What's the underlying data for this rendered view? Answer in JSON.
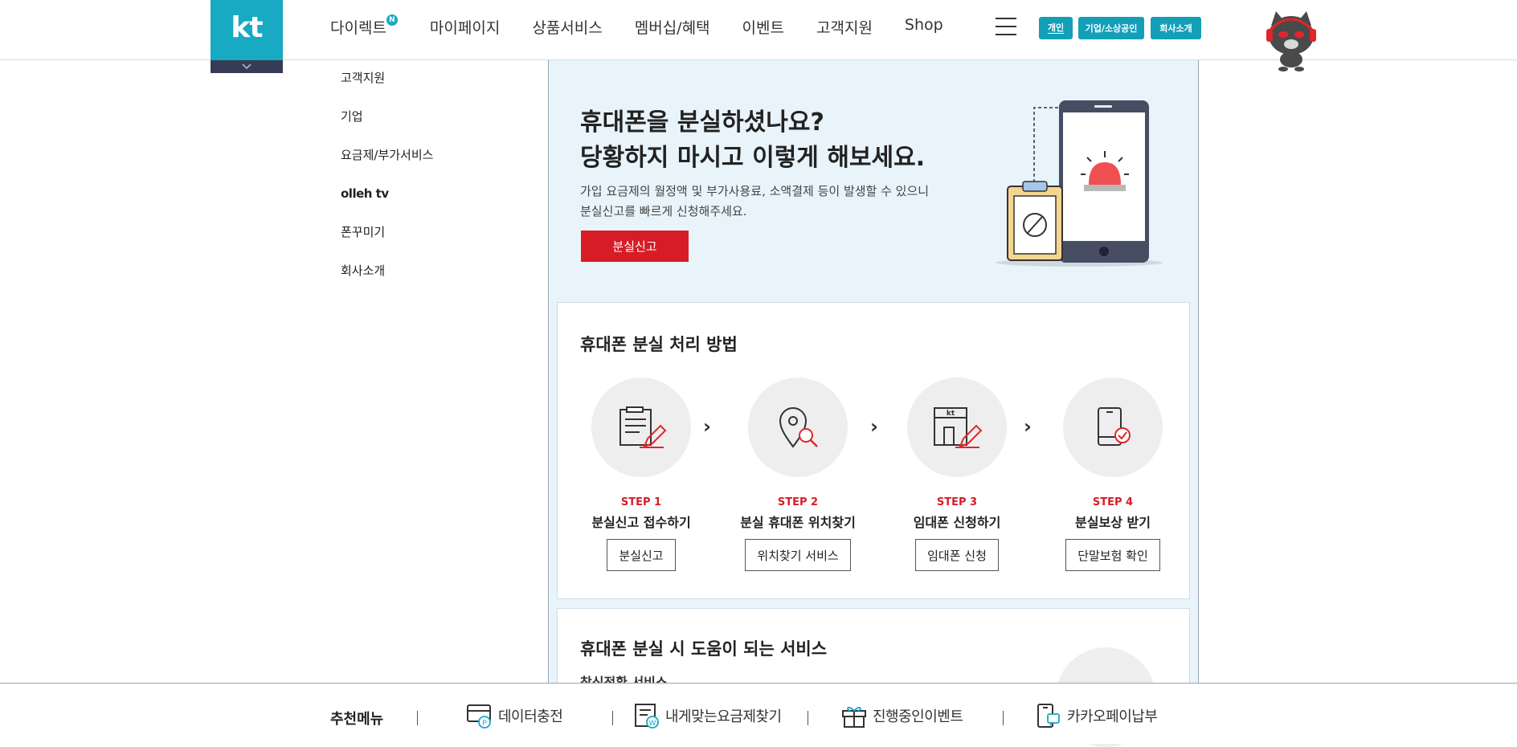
{
  "header": {
    "logo": "kt",
    "gnb": [
      {
        "label": "다이렉트",
        "badge": "N"
      },
      {
        "label": "마이페이지"
      },
      {
        "label": "상품서비스"
      },
      {
        "label": "멤버십/혜택"
      },
      {
        "label": "이벤트"
      },
      {
        "label": "고객지원"
      },
      {
        "label": "Shop"
      }
    ],
    "segments": [
      "개인",
      "기업/소상공인",
      "회사소개"
    ]
  },
  "lnb": [
    "고객지원",
    "기업",
    "요금제/부가서비스",
    "olleh tv",
    "폰꾸미기",
    "회사소개"
  ],
  "hero": {
    "title_line1": "휴대폰을 분실하셨나요?",
    "title_line2": "당황하지 마시고 이렇게 해보세요.",
    "desc_line1": "가입 요금제의 월정액 및 부가사용료, 소액결제 등이 발생할 수 있으니",
    "desc_line2": "분실신고를 빠르게 신청해주세요.",
    "button": "분실신고"
  },
  "process": {
    "title": "휴대폰 분실 처리 방법",
    "steps": [
      {
        "no": "STEP 1",
        "name": "분실신고 접수하기",
        "button": "분실신고",
        "icon": "clipboard-pencil-icon"
      },
      {
        "no": "STEP 2",
        "name": "분실 휴대폰 위치찾기",
        "button": "위치찾기 서비스",
        "icon": "location-search-icon"
      },
      {
        "no": "STEP 3",
        "name": "임대폰 신청하기",
        "button": "임대폰 신청",
        "icon": "store-pencil-icon"
      },
      {
        "no": "STEP 4",
        "name": "분실보상 받기",
        "button": "단말보험 확인",
        "icon": "phone-check-icon"
      }
    ]
  },
  "services": {
    "title": "휴대폰 분실 시 도움이 되는 서비스",
    "subtitle": "착신전환 서비스"
  },
  "bottom": {
    "label": "추천메뉴",
    "items": [
      {
        "label": "데이터충전",
        "icon": "data-charge-icon"
      },
      {
        "label": "내게맞는요금제찾기",
        "icon": "plan-finder-icon"
      },
      {
        "label": "진행중인이벤트",
        "icon": "gift-icon"
      },
      {
        "label": "카카오페이납부",
        "icon": "kakaopay-icon"
      }
    ]
  },
  "colors": {
    "brand": "#18a9c3",
    "accent": "#d71c25",
    "hero_bg": "#e8f4fa"
  }
}
